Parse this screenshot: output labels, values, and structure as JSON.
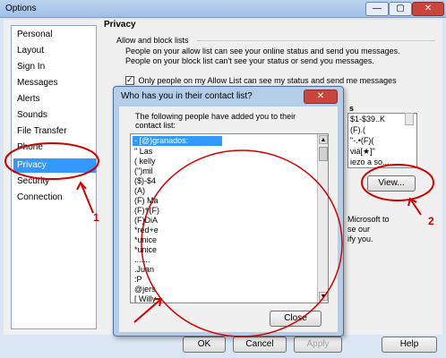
{
  "window": {
    "title": "Options",
    "minimize": "—",
    "maximize": "▢",
    "close": "✕"
  },
  "sidebar": {
    "items": [
      {
        "label": "Personal"
      },
      {
        "label": "Layout"
      },
      {
        "label": "Sign In"
      },
      {
        "label": "Messages"
      },
      {
        "label": "Alerts"
      },
      {
        "label": "Sounds"
      },
      {
        "label": "File Transfer"
      },
      {
        "label": "Phone"
      },
      {
        "label": "Privacy"
      },
      {
        "label": "Security"
      },
      {
        "label": "Connection"
      }
    ],
    "selected": "Privacy"
  },
  "privacy": {
    "heading": "Privacy",
    "section": "Allow and block lists",
    "description": "People on your allow list can see your online status and send you messages.  People on your block list can't see your status or send you messages.",
    "checkbox_label": "Only people on my Allow List can see my status and send me messages",
    "right_list_header": "s",
    "right_list_rows": [
      "$1-$39..K",
      "(F).(",
      "\"-.•(F)(",
      "viá[★]\"",
      "iezo a so..."
    ],
    "view_button": "View...",
    "right_text_1": "Microsoft to",
    "right_text_2": "se our",
    "right_text_3": "ify you."
  },
  "dialog": {
    "title": "Who has you in their contact list?",
    "close": "✕",
    "message": "The following people have added you to their contact list:",
    "rows": [
      "- [@)granados:",
      "\" Las",
      "( kelly",
      "(\")mil",
      "($)-$4",
      "(A)",
      "(F) Ma",
      "(F)†(F)",
      "(F)DiA",
      "*red+e",
      "*unice",
      "*unice",
      ".......",
      ".Juan",
      ":P",
      "@jers",
      "[ Willy"
    ],
    "close_button": "Close"
  },
  "footer": {
    "ok": "OK",
    "cancel": "Cancel",
    "apply": "Apply",
    "help": "Help"
  },
  "annotations": {
    "label_1": "1",
    "label_2": "2",
    "color": "#d40000"
  }
}
